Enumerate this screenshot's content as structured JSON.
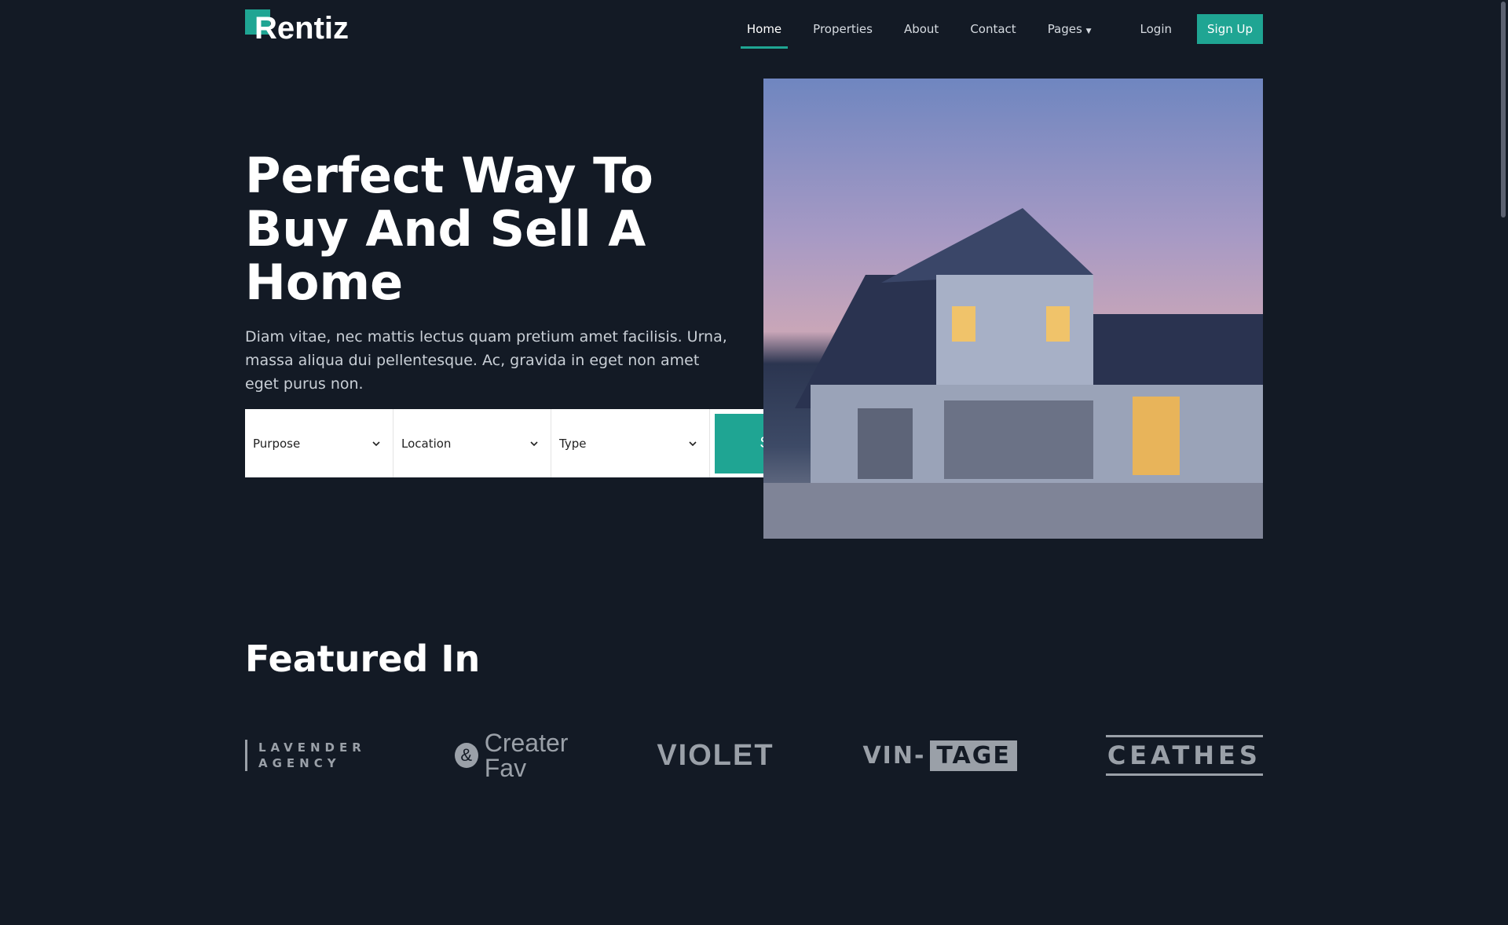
{
  "brand": {
    "name": "Rentiz",
    "accent": "#1fa593",
    "background": "#131a25"
  },
  "nav": {
    "items": [
      "Home",
      "Properties",
      "About",
      "Contact",
      "Pages"
    ],
    "active": "Home",
    "login": "Login",
    "signup": "Sign Up"
  },
  "hero": {
    "title": "Perfect Way To Buy And Sell A Home",
    "lead": "Diam vitae, nec mattis lectus quam pretium amet facilisis. Urna, massa aliqua dui pellentesque. Ac, gravida in eget non amet eget purus non."
  },
  "search": {
    "purpose": "Purpose",
    "location": "Location",
    "type": "Type",
    "button": "Search"
  },
  "featured": {
    "title": "Featured In",
    "logos": {
      "lavender1": "LAVENDER",
      "lavender2": "AGENCY",
      "creater1": "Creater",
      "creater2": "Fav",
      "violet": "VIOLET",
      "vin": "VIN-",
      "tage": "TAGE",
      "ceathes": "CEATHES"
    }
  }
}
